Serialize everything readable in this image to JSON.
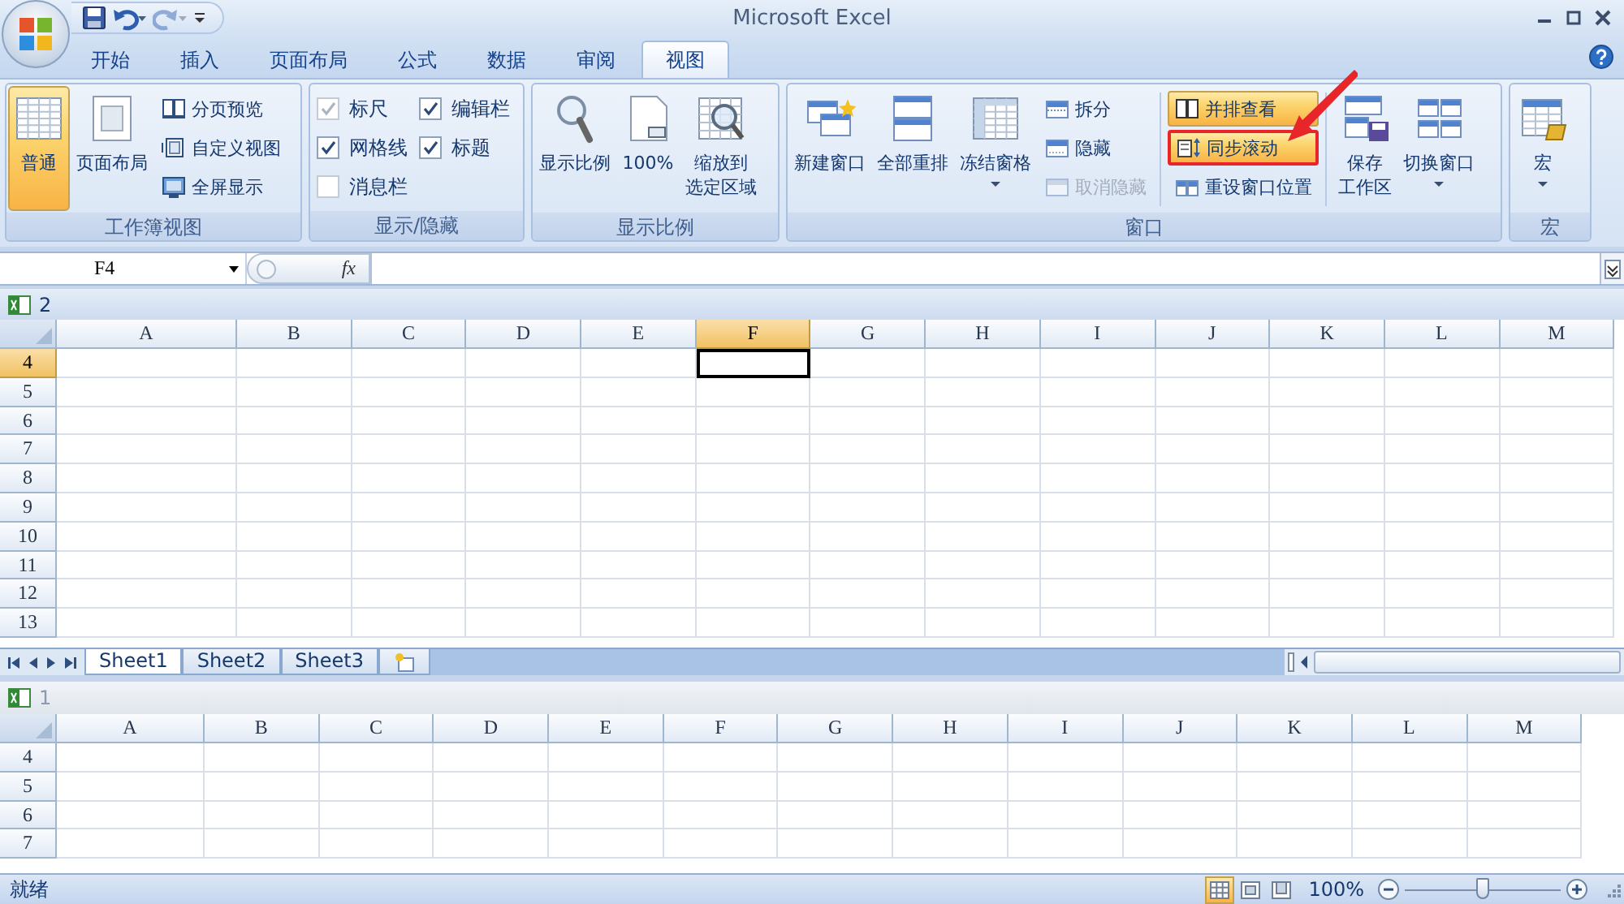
{
  "window": {
    "title": "Microsoft Excel"
  },
  "quick_access": [
    {
      "kind": "save",
      "disabled": false
    },
    {
      "kind": "undo",
      "disabled": false
    },
    {
      "kind": "redo",
      "disabled": true
    },
    {
      "kind": "customize",
      "disabled": false
    }
  ],
  "ribbon_tabs": [
    {
      "label": "开始",
      "selected": false
    },
    {
      "label": "插入",
      "selected": false
    },
    {
      "label": "页面布局",
      "selected": false
    },
    {
      "label": "公式",
      "selected": false
    },
    {
      "label": "数据",
      "selected": false
    },
    {
      "label": "审阅",
      "selected": false
    },
    {
      "label": "视图",
      "selected": true
    }
  ],
  "ribbon_groups": [
    {
      "label": "工作簿视图",
      "controls": [
        {
          "kind": "large",
          "label": "普通",
          "selected": true,
          "disabled": false
        },
        {
          "kind": "large",
          "label": "页面布局",
          "selected": false,
          "disabled": false
        },
        {
          "kind": "small",
          "label": "分页预览",
          "selected": false,
          "disabled": false
        },
        {
          "kind": "small",
          "label": "自定义视图",
          "selected": false,
          "disabled": false
        },
        {
          "kind": "small",
          "label": "全屏显示",
          "selected": false,
          "disabled": false
        }
      ]
    },
    {
      "label": "显示/隐藏",
      "controls": [
        {
          "kind": "check",
          "label": "标尺",
          "checked": true,
          "disabled": true
        },
        {
          "kind": "check",
          "label": "网格线",
          "checked": true,
          "disabled": false
        },
        {
          "kind": "check",
          "label": "消息栏",
          "checked": false,
          "disabled": true
        },
        {
          "kind": "check",
          "label": "编辑栏",
          "checked": true,
          "disabled": false
        },
        {
          "kind": "check",
          "label": "标题",
          "checked": true,
          "disabled": false
        }
      ]
    },
    {
      "label": "显示比例",
      "controls": [
        {
          "kind": "large",
          "label": "显示比例",
          "selected": false,
          "disabled": false
        },
        {
          "kind": "large",
          "label": "100%",
          "selected": false,
          "disabled": false
        },
        {
          "kind": "large",
          "lines": [
            "缩放到",
            "选定区域"
          ],
          "selected": false,
          "disabled": false
        }
      ]
    },
    {
      "label": "窗口",
      "controls": [
        {
          "kind": "large",
          "label": "新建窗口",
          "selected": false,
          "disabled": false
        },
        {
          "kind": "large",
          "label": "全部重排",
          "selected": false,
          "disabled": false
        },
        {
          "kind": "large",
          "label": "冻结窗格",
          "selected": false,
          "disabled": false,
          "dropdown": true
        },
        {
          "kind": "small",
          "label": "拆分",
          "selected": false,
          "disabled": false
        },
        {
          "kind": "small",
          "label": "隐藏",
          "selected": false,
          "disabled": false
        },
        {
          "kind": "small",
          "label": "取消隐藏",
          "selected": false,
          "disabled": true
        },
        {
          "kind": "separator"
        },
        {
          "kind": "small",
          "label": "并排查看",
          "selected": true,
          "disabled": false
        },
        {
          "kind": "small",
          "label": "同步滚动",
          "selected": true,
          "disabled": false,
          "highlighted": true
        },
        {
          "kind": "small",
          "label": "重设窗口位置",
          "selected": false,
          "disabled": false
        },
        {
          "kind": "separator"
        },
        {
          "kind": "large",
          "lines": [
            "保存",
            "工作区"
          ],
          "selected": false,
          "disabled": false
        },
        {
          "kind": "large",
          "label": "切换窗口",
          "selected": false,
          "disabled": false,
          "dropdown": true
        }
      ]
    },
    {
      "label": "宏",
      "controls": [
        {
          "kind": "large",
          "label": "宏",
          "selected": false,
          "disabled": false,
          "dropdown": true
        }
      ]
    }
  ],
  "formula_bar": {
    "name_box": "F4",
    "function_button": "fx"
  },
  "windows": [
    {
      "title": "2",
      "active": true,
      "columns": [
        {
          "label": "A",
          "selected": false
        },
        {
          "label": "B",
          "selected": false
        },
        {
          "label": "C",
          "selected": false
        },
        {
          "label": "D",
          "selected": false
        },
        {
          "label": "E",
          "selected": false
        },
        {
          "label": "F",
          "selected": true
        },
        {
          "label": "G",
          "selected": false
        },
        {
          "label": "H",
          "selected": false
        },
        {
          "label": "I",
          "selected": false
        },
        {
          "label": "J",
          "selected": false
        },
        {
          "label": "K",
          "selected": false
        },
        {
          "label": "L",
          "selected": false
        },
        {
          "label": "M",
          "selected": false
        }
      ],
      "rows": [
        {
          "label": "4",
          "selected": true
        },
        {
          "label": "5",
          "selected": false
        },
        {
          "label": "6",
          "selected": false
        },
        {
          "label": "7",
          "selected": false
        },
        {
          "label": "8",
          "selected": false
        },
        {
          "label": "9",
          "selected": false
        },
        {
          "label": "10",
          "selected": false
        },
        {
          "label": "11",
          "selected": false
        },
        {
          "label": "12",
          "selected": false
        },
        {
          "label": "13",
          "selected": false
        }
      ],
      "sheet_tabs": [
        {
          "label": "Sheet1",
          "selected": true
        },
        {
          "label": "Sheet2",
          "selected": false
        },
        {
          "label": "Sheet3",
          "selected": false
        }
      ]
    },
    {
      "title": "1",
      "active": false,
      "columns": [
        {
          "label": "A",
          "selected": false
        },
        {
          "label": "B",
          "selected": false
        },
        {
          "label": "C",
          "selected": false
        },
        {
          "label": "D",
          "selected": false
        },
        {
          "label": "E",
          "selected": false
        },
        {
          "label": "F",
          "selected": false
        },
        {
          "label": "G",
          "selected": false
        },
        {
          "label": "H",
          "selected": false
        },
        {
          "label": "I",
          "selected": false
        },
        {
          "label": "J",
          "selected": false
        },
        {
          "label": "K",
          "selected": false
        },
        {
          "label": "L",
          "selected": false
        },
        {
          "label": "M",
          "selected": false
        }
      ],
      "rows": [
        {
          "label": "4",
          "selected": false
        },
        {
          "label": "5",
          "selected": false
        },
        {
          "label": "6",
          "selected": false
        },
        {
          "label": "7",
          "selected": false
        }
      ]
    }
  ],
  "status_bar": {
    "status": "就绪",
    "views": [
      {
        "selected": true
      },
      {
        "selected": false
      },
      {
        "selected": false
      }
    ],
    "zoom": "100%",
    "zoom_slider": {
      "level": 0.5
    }
  }
}
